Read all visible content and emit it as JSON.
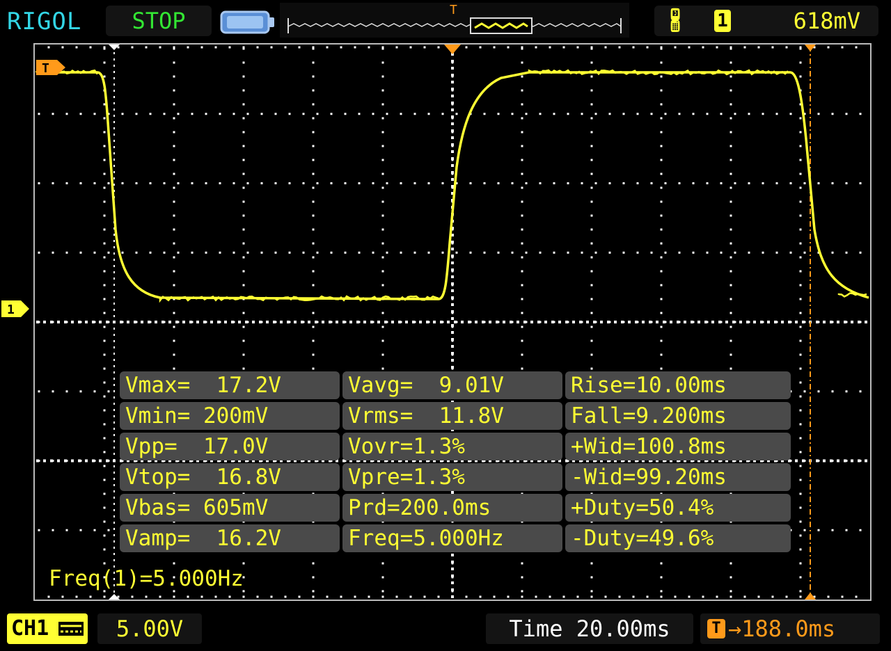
{
  "top_bar": {
    "brand": "RIGOL",
    "run_state": "STOP",
    "battery_icon": "battery-icon",
    "trigger_edge_icon": "rising-edge-icon",
    "trigger_source": "1",
    "trigger_level": "618mV"
  },
  "markers": {
    "trigger_top": "T",
    "trigger_left": "T",
    "channel_marker": "1"
  },
  "measurements": [
    [
      "Vmax=  17.2V",
      "Vavg=  9.01V",
      "Rise=10.00ms"
    ],
    [
      "Vmin= 200mV",
      "Vrms=  11.8V",
      "Fall=9.200ms"
    ],
    [
      "Vpp=  17.0V",
      "Vovr=1.3%",
      "+Wid=100.8ms"
    ],
    [
      "Vtop=  16.8V",
      "Vpre=1.3%",
      "-Wid=99.20ms"
    ],
    [
      "Vbas= 605mV",
      "Prd=200.0ms",
      "+Duty=50.4%"
    ],
    [
      "Vamp=  16.2V",
      "Freq=5.000Hz",
      "-Duty=49.6%"
    ]
  ],
  "freq_readout": "Freq(1)=5.000Hz",
  "bottom_bar": {
    "channel_label": "CH1",
    "coupling_icon": "dc-coupling-icon",
    "channel_scale": "5.00V",
    "timebase": "Time 20.00ms",
    "trigger_offset_label": "T",
    "trigger_offset": "188.0ms"
  },
  "colors": {
    "trace": "#ffff33",
    "trigger": "#ff9a1a",
    "brand": "#33d6e6",
    "run_state": "#33e633",
    "panel": "#4a4a4a"
  }
}
